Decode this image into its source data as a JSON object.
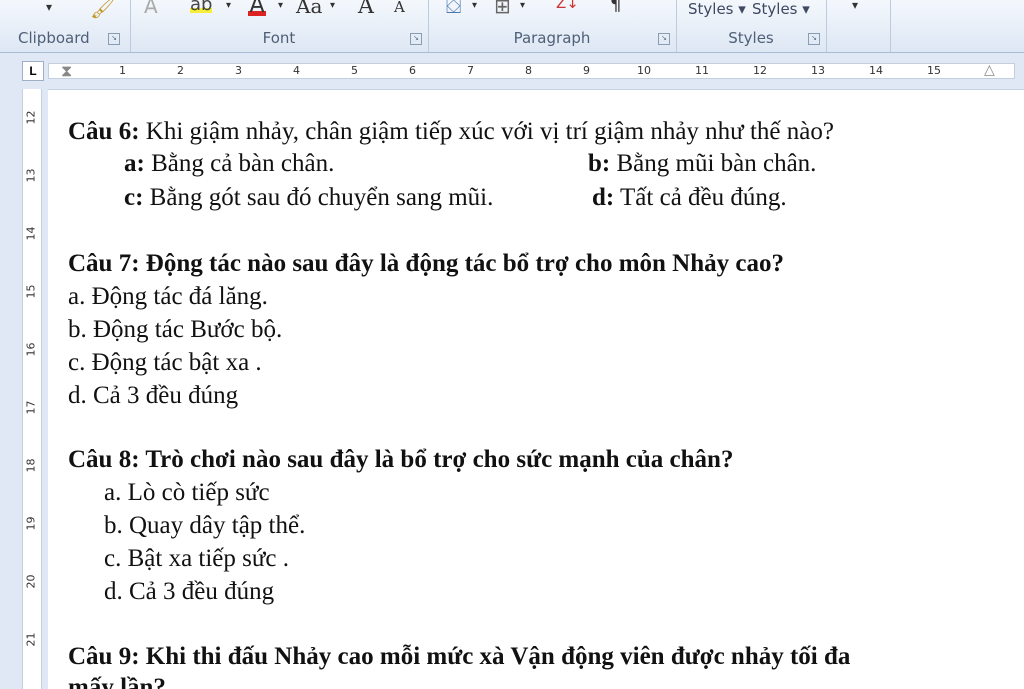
{
  "ribbon": {
    "groups": {
      "clipboard": "Clipboard",
      "font": "Font",
      "paragraph": "Paragraph",
      "styles": "Styles"
    },
    "font_tools": {
      "change_case": "Aa",
      "grow_font": "A",
      "shrink_font": "A"
    },
    "styles_buttons": [
      "Styles",
      "Styles"
    ],
    "icons": [
      "paste-brush-icon",
      "highlight-icon",
      "font-color-icon",
      "shading-icon",
      "borders-icon",
      "sort-icon",
      "pilcrow-icon",
      "dropdown-icon"
    ]
  },
  "ruler": {
    "tab_selector": "L",
    "h_numbers": [
      "1",
      "2",
      "3",
      "4",
      "5",
      "6",
      "7",
      "8",
      "9",
      "10",
      "11",
      "12",
      "13",
      "14",
      "15"
    ],
    "v_numbers": [
      "12",
      "13",
      "14",
      "15",
      "16",
      "17",
      "18",
      "19",
      "20",
      "21"
    ]
  },
  "document": {
    "q6": {
      "prefix": "Câu 6:",
      "text": " Khi giậm nhảy, chân giậm tiếp xúc với vị trí giậm nhảy như thế nào?",
      "a_key": "a:",
      "a_text": " Bằng cả bàn chân.",
      "b_key": "b:",
      "b_text": " Bằng mũi bàn chân.",
      "c_key": "c:",
      "c_text": " Bằng gót sau đó chuyển sang mũi.",
      "d_key": "d:",
      "d_text": " Tất cả đều đúng."
    },
    "q7": {
      "question": "Câu 7: Động tác nào sau đây là động tác bổ trợ cho môn Nhảy cao?",
      "options": [
        "a.  Động tác đá lăng.",
        "b.  Động tác Bước bộ.",
        "c.  Động tác bật xa .",
        "d.  Cả 3 đều đúng"
      ]
    },
    "q8": {
      "question": "Câu 8: Trò chơi nào sau đây là bổ trợ cho sức mạnh của chân?",
      "options": [
        "a.  Lò cò tiếp sức",
        "b.  Quay dây tập thể.",
        "c.  Bật xa tiếp sức .",
        "d.  Cả 3 đều đúng"
      ]
    },
    "q9": {
      "question": "Câu 9: Khi thi đấu Nhảy cao mỗi mức xà Vận động viên được nhảy tối đa",
      "continuation": "mấy lần?"
    }
  }
}
